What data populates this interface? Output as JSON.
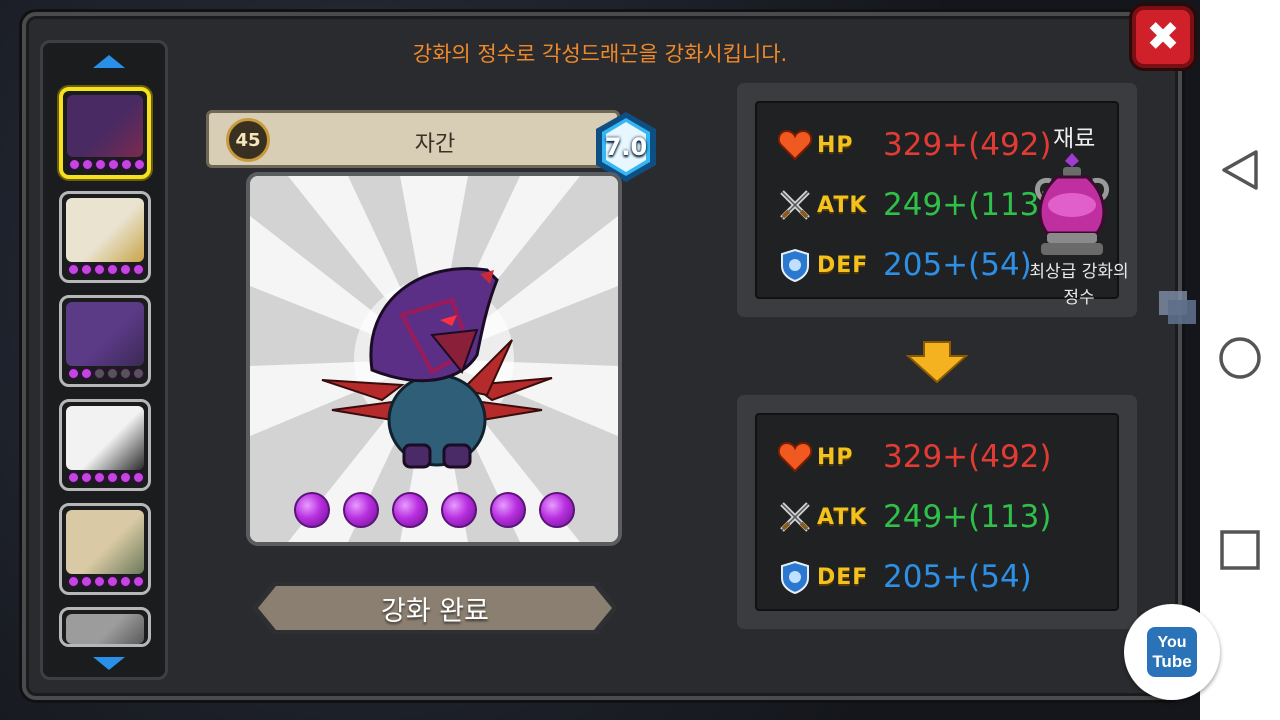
{
  "instruction": "강화의 정수로 각성드래곤을 강화시킵니다.",
  "close_icon": "close-x-icon",
  "sidebar": {
    "slots": [
      {
        "name": "dragon-purple-hood",
        "stars_on": 6,
        "colors": [
          "#4a2a62",
          "#7b2a4e"
        ],
        "selected": true
      },
      {
        "name": "dragon-white-gold",
        "stars_on": 6,
        "colors": [
          "#e9e3cf",
          "#c9a44a"
        ],
        "selected": false
      },
      {
        "name": "dragon-purple-horned",
        "stars_on": 2,
        "colors": [
          "#5b3a86",
          "#3b2a55"
        ],
        "selected": false
      },
      {
        "name": "dragon-zebra",
        "stars_on": 6,
        "colors": [
          "#f2f2f2",
          "#2a2a2a"
        ],
        "selected": false
      },
      {
        "name": "dragon-beige-eye",
        "stars_on": 6,
        "colors": [
          "#d9c9a4",
          "#6b7a5a"
        ],
        "selected": false
      },
      {
        "name": "dragon-gray-spiky",
        "stars_on": 0,
        "colors": [
          "#9c9c9c",
          "#5a5a5a"
        ],
        "selected": false
      }
    ]
  },
  "card": {
    "level": "45",
    "name": "자간",
    "grade": "7.0",
    "star_count": 6
  },
  "complete_button": "강화 완료",
  "current_stats": {
    "hp_label": "HP",
    "hp_value": "329+(492)",
    "atk_label": "ATK",
    "atk_value": "249+(113)",
    "def_label": "DEF",
    "def_value": "205+(54)"
  },
  "material": {
    "title": "재료",
    "name_line1": "최상급 강화의",
    "name_line2": "정수"
  },
  "result_stats": {
    "hp_label": "HP",
    "hp_value": "329+(492)",
    "atk_label": "ATK",
    "atk_value": "249+(113)",
    "def_label": "DEF",
    "def_value": "205+(54)"
  },
  "colors": {
    "hp": "#e23b33",
    "atk": "#2fc04a",
    "def": "#2e8fe6",
    "instruction": "#f0892a",
    "close": "#d0212b"
  },
  "navbar": {
    "buttons": [
      "back-icon",
      "home-icon",
      "recents-icon"
    ]
  },
  "youtube": {
    "line1": "You",
    "line2": "Tube"
  }
}
